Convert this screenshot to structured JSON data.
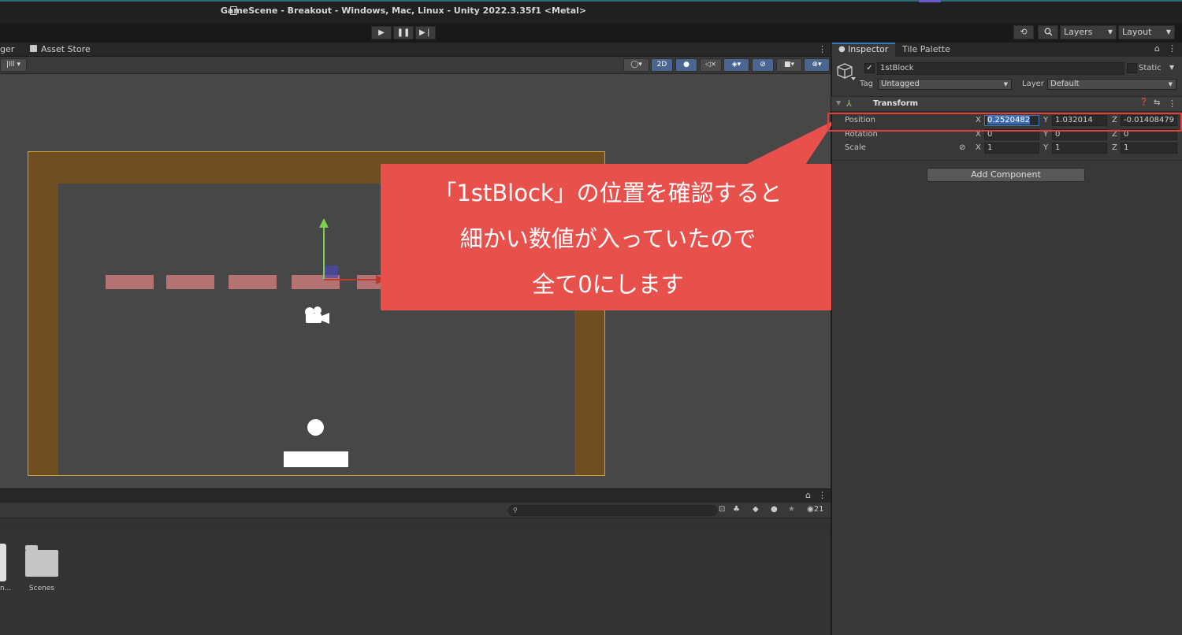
{
  "window": {
    "title": "GameScene - Breakout - Windows, Mac, Linux - Unity 2022.3.35f1 <Metal>"
  },
  "toolbar": {
    "play_icon": "play-icon",
    "pause_icon": "pause-icon",
    "step_icon": "step-icon",
    "layers_label": "Layers",
    "layout_label": "Layout"
  },
  "scene_panel": {
    "tabs": [
      {
        "label": "ger"
      },
      {
        "label": "Asset Store"
      }
    ],
    "toolbar": {
      "mode_2d_label": "2D"
    }
  },
  "callout": {
    "lines": [
      "「1stBlock」の位置を確認すると",
      "細かい数値が入っていたので",
      "全て0にします"
    ]
  },
  "bottom_panel": {
    "count_label": "21",
    "folders": [
      {
        "label": "n..."
      },
      {
        "label": "Scenes"
      }
    ]
  },
  "inspector": {
    "tabs": [
      {
        "label": "Inspector"
      },
      {
        "label": "Tile Palette"
      }
    ],
    "object": {
      "name": "1stBlock",
      "active": true,
      "static_label": "Static",
      "tag_label": "Tag",
      "tag_value": "Untagged",
      "layer_label": "Layer",
      "layer_value": "Default"
    },
    "transform": {
      "title": "Transform",
      "position": {
        "label": "Position",
        "x": "0.2520482",
        "y": "1.032014",
        "z": "-0.01408479"
      },
      "rotation": {
        "label": "Rotation",
        "x": "0",
        "y": "0",
        "z": "0"
      },
      "scale": {
        "label": "Scale",
        "x": "1",
        "y": "1",
        "z": "1"
      },
      "axis_x": "X",
      "axis_y": "Y",
      "axis_z": "Z"
    },
    "add_component_label": "Add Component"
  },
  "colors": {
    "callout": "#e8504b",
    "wall": "#6f4e21",
    "block": "#c97a7a",
    "scene_bg": "#474747",
    "highlight": "#e0403b"
  }
}
